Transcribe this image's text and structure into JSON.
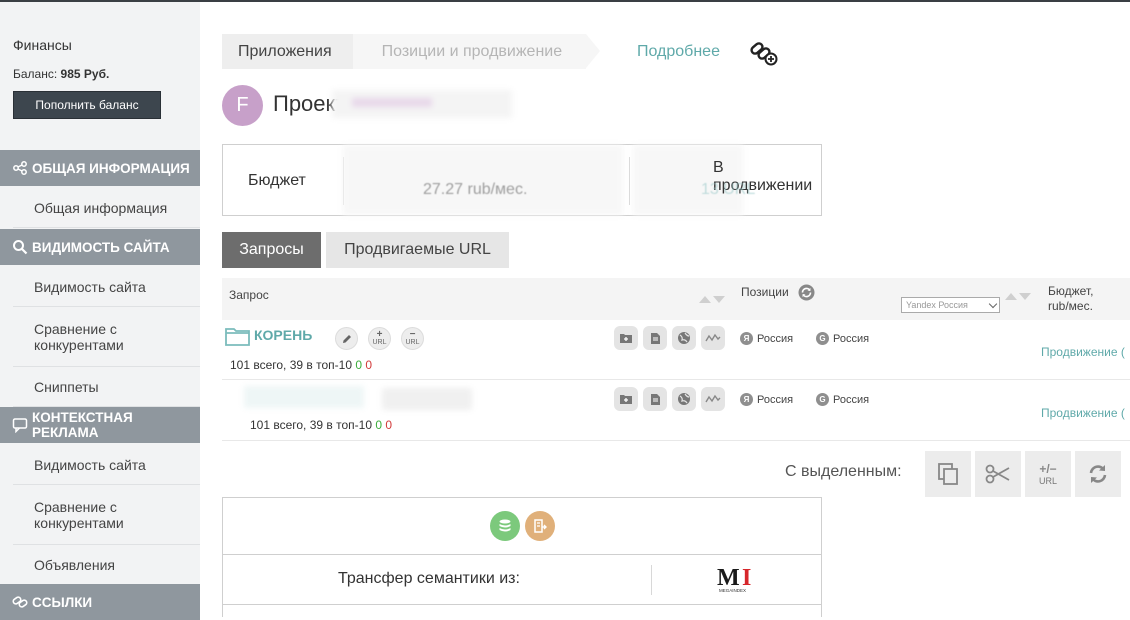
{
  "sidebar": {
    "finance_title": "Финансы",
    "balance_label": "Баланс:",
    "balance_value": "985 Руб.",
    "topup_button": "Пополнить баланс",
    "sections": [
      {
        "label": "Общая информация",
        "items": [
          "Общая информация"
        ]
      },
      {
        "label": "Видимость сайта",
        "items": [
          "Видимость сайта",
          "Сравнение с конкурентами",
          "Сниппеты"
        ]
      },
      {
        "label": "Контекстная реклама",
        "items": [
          "Видимость сайта",
          "Сравнение с конкурентами",
          "Объявления"
        ]
      },
      {
        "label": "Ссылки",
        "items": []
      }
    ]
  },
  "breadcrumb": {
    "items": [
      "Приложения",
      "Позиции и продвижение"
    ],
    "more_link": "Подробнее"
  },
  "project": {
    "avatar_letter": "F",
    "title_prefix": "Проект"
  },
  "budget": {
    "label": "Бюджет",
    "amount": "27.27 rub/мес.",
    "promo_label": "В продвижении",
    "promo_count": "13 URL"
  },
  "tabs": [
    {
      "label": "Запросы",
      "active": true
    },
    {
      "label": "Продвигаемые URL",
      "active": false
    }
  ],
  "table": {
    "headers": {
      "query": "Запрос",
      "positions": "Позиции",
      "engine_select": "Yandex Россия",
      "budget_line1": "Бюджет,",
      "budget_line2": "rub/мес."
    },
    "rows": [
      {
        "label": "КОРЕНЬ",
        "count_text": "101 всего, 39 в топ-10",
        "green": "0",
        "red": "0",
        "region_yandex": "Россия",
        "region_google": "Россия",
        "promo": "Продвижение ("
      },
      {
        "label": "",
        "count_text": "101 всего, 39 в топ-10",
        "green": "0",
        "red": "0",
        "region_yandex": "Россия",
        "region_google": "Россия",
        "promo": "Продвижение ("
      }
    ],
    "url_small": "URL",
    "plus": "+",
    "minus": "−"
  },
  "selection": {
    "label": "С выделенным:",
    "url_btn_top": "+/−",
    "url_btn_bottom": "URL"
  },
  "transfer": {
    "label": "Трансфер семантики из:",
    "logo_text": "MI",
    "logo_sub": "MEGAINDEX"
  },
  "colors": {
    "accent": "#5fa9a9",
    "sidebar_head": "#8f979e",
    "sidebar_bg": "#f2f3f4",
    "tab_active": "#6d6d6d",
    "button_dark": "#3d464e"
  }
}
